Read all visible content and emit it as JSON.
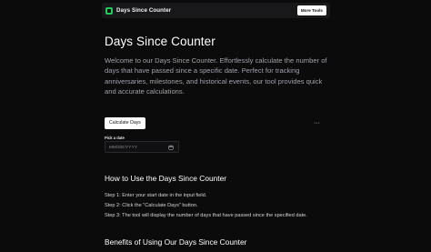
{
  "nav": {
    "brand_name": "Days Since Counter",
    "more_tools_label": "More Tools"
  },
  "hero": {
    "title": "Days Since Counter",
    "intro": "Welcome to our Days Since Counter. Effortlessly calculate the number of days that have passed since a specific date. Perfect for tracking anniversaries, milestones, and historical events, our tool provides quick and accurate calculations."
  },
  "calculator": {
    "calculate_label": "Calculate Days",
    "more_label": "···",
    "date_label": "Pick a date",
    "date_placeholder": "MM/DD/YYYY"
  },
  "howto": {
    "heading": "How to Use the Days Since Counter",
    "steps": [
      "Step 1: Enter your start date in the input field.",
      "Step 2: Click the \"Calculate Days\" button.",
      "Step 3: The tool will display the number of days that have passed since the specified date."
    ]
  },
  "benefits": {
    "heading": "Benefits of Using Our Days Since Counter"
  },
  "colors": {
    "background": "#0b0b0c",
    "brand_accent": "#22c55e",
    "button_bg": "#ffffff"
  },
  "icons": {
    "brand": "app-logo-icon",
    "date": "calendar-icon",
    "more": "more-dots-icon"
  }
}
